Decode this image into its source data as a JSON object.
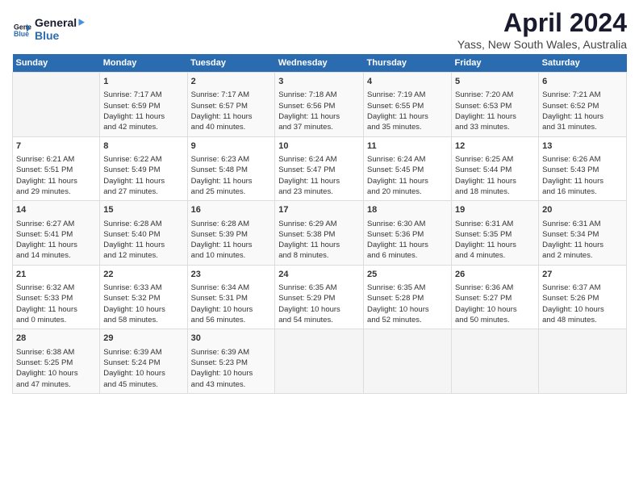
{
  "header": {
    "logo_line1": "General",
    "logo_line2": "Blue",
    "month_title": "April 2024",
    "subtitle": "Yass, New South Wales, Australia"
  },
  "weekdays": [
    "Sunday",
    "Monday",
    "Tuesday",
    "Wednesday",
    "Thursday",
    "Friday",
    "Saturday"
  ],
  "weeks": [
    [
      {
        "day": "",
        "data": ""
      },
      {
        "day": "1",
        "data": "Sunrise: 7:17 AM\nSunset: 6:59 PM\nDaylight: 11 hours\nand 42 minutes."
      },
      {
        "day": "2",
        "data": "Sunrise: 7:17 AM\nSunset: 6:57 PM\nDaylight: 11 hours\nand 40 minutes."
      },
      {
        "day": "3",
        "data": "Sunrise: 7:18 AM\nSunset: 6:56 PM\nDaylight: 11 hours\nand 37 minutes."
      },
      {
        "day": "4",
        "data": "Sunrise: 7:19 AM\nSunset: 6:55 PM\nDaylight: 11 hours\nand 35 minutes."
      },
      {
        "day": "5",
        "data": "Sunrise: 7:20 AM\nSunset: 6:53 PM\nDaylight: 11 hours\nand 33 minutes."
      },
      {
        "day": "6",
        "data": "Sunrise: 7:21 AM\nSunset: 6:52 PM\nDaylight: 11 hours\nand 31 minutes."
      }
    ],
    [
      {
        "day": "7",
        "data": "Sunrise: 6:21 AM\nSunset: 5:51 PM\nDaylight: 11 hours\nand 29 minutes."
      },
      {
        "day": "8",
        "data": "Sunrise: 6:22 AM\nSunset: 5:49 PM\nDaylight: 11 hours\nand 27 minutes."
      },
      {
        "day": "9",
        "data": "Sunrise: 6:23 AM\nSunset: 5:48 PM\nDaylight: 11 hours\nand 25 minutes."
      },
      {
        "day": "10",
        "data": "Sunrise: 6:24 AM\nSunset: 5:47 PM\nDaylight: 11 hours\nand 23 minutes."
      },
      {
        "day": "11",
        "data": "Sunrise: 6:24 AM\nSunset: 5:45 PM\nDaylight: 11 hours\nand 20 minutes."
      },
      {
        "day": "12",
        "data": "Sunrise: 6:25 AM\nSunset: 5:44 PM\nDaylight: 11 hours\nand 18 minutes."
      },
      {
        "day": "13",
        "data": "Sunrise: 6:26 AM\nSunset: 5:43 PM\nDaylight: 11 hours\nand 16 minutes."
      }
    ],
    [
      {
        "day": "14",
        "data": "Sunrise: 6:27 AM\nSunset: 5:41 PM\nDaylight: 11 hours\nand 14 minutes."
      },
      {
        "day": "15",
        "data": "Sunrise: 6:28 AM\nSunset: 5:40 PM\nDaylight: 11 hours\nand 12 minutes."
      },
      {
        "day": "16",
        "data": "Sunrise: 6:28 AM\nSunset: 5:39 PM\nDaylight: 11 hours\nand 10 minutes."
      },
      {
        "day": "17",
        "data": "Sunrise: 6:29 AM\nSunset: 5:38 PM\nDaylight: 11 hours\nand 8 minutes."
      },
      {
        "day": "18",
        "data": "Sunrise: 6:30 AM\nSunset: 5:36 PM\nDaylight: 11 hours\nand 6 minutes."
      },
      {
        "day": "19",
        "data": "Sunrise: 6:31 AM\nSunset: 5:35 PM\nDaylight: 11 hours\nand 4 minutes."
      },
      {
        "day": "20",
        "data": "Sunrise: 6:31 AM\nSunset: 5:34 PM\nDaylight: 11 hours\nand 2 minutes."
      }
    ],
    [
      {
        "day": "21",
        "data": "Sunrise: 6:32 AM\nSunset: 5:33 PM\nDaylight: 11 hours\nand 0 minutes."
      },
      {
        "day": "22",
        "data": "Sunrise: 6:33 AM\nSunset: 5:32 PM\nDaylight: 10 hours\nand 58 minutes."
      },
      {
        "day": "23",
        "data": "Sunrise: 6:34 AM\nSunset: 5:31 PM\nDaylight: 10 hours\nand 56 minutes."
      },
      {
        "day": "24",
        "data": "Sunrise: 6:35 AM\nSunset: 5:29 PM\nDaylight: 10 hours\nand 54 minutes."
      },
      {
        "day": "25",
        "data": "Sunrise: 6:35 AM\nSunset: 5:28 PM\nDaylight: 10 hours\nand 52 minutes."
      },
      {
        "day": "26",
        "data": "Sunrise: 6:36 AM\nSunset: 5:27 PM\nDaylight: 10 hours\nand 50 minutes."
      },
      {
        "day": "27",
        "data": "Sunrise: 6:37 AM\nSunset: 5:26 PM\nDaylight: 10 hours\nand 48 minutes."
      }
    ],
    [
      {
        "day": "28",
        "data": "Sunrise: 6:38 AM\nSunset: 5:25 PM\nDaylight: 10 hours\nand 47 minutes."
      },
      {
        "day": "29",
        "data": "Sunrise: 6:39 AM\nSunset: 5:24 PM\nDaylight: 10 hours\nand 45 minutes."
      },
      {
        "day": "30",
        "data": "Sunrise: 6:39 AM\nSunset: 5:23 PM\nDaylight: 10 hours\nand 43 minutes."
      },
      {
        "day": "",
        "data": ""
      },
      {
        "day": "",
        "data": ""
      },
      {
        "day": "",
        "data": ""
      },
      {
        "day": "",
        "data": ""
      }
    ]
  ]
}
